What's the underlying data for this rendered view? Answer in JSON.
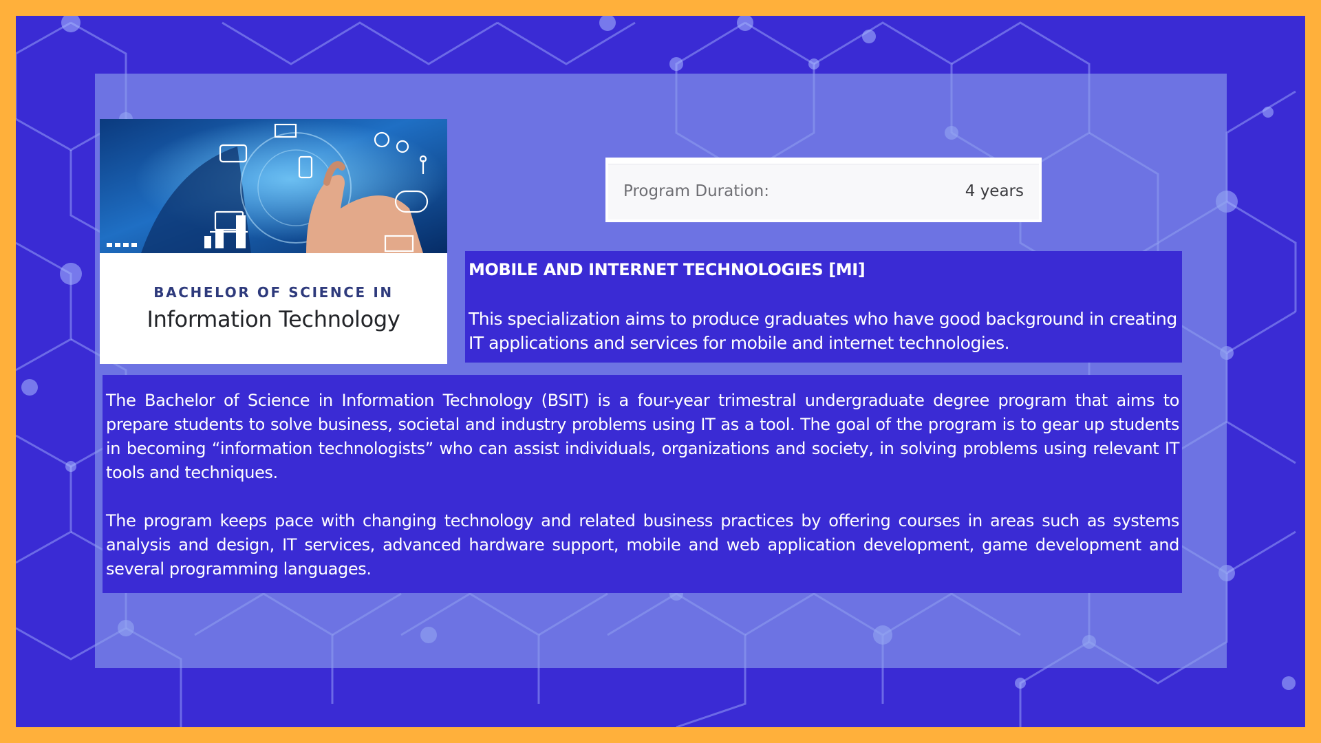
{
  "colors": {
    "frame": "#FFB03B",
    "background": "#3A2BD4",
    "panel": "#8CA0EB",
    "text_box": "#3A2BD4",
    "hero_subtitle": "#2E3A7C"
  },
  "hero": {
    "image_alt": "hand touching digital interface icons",
    "subtitle": "BACHELOR OF SCIENCE IN",
    "title": "Information Technology"
  },
  "program": {
    "duration_label": "Program Duration:",
    "duration_value": "4 years"
  },
  "specialization": {
    "title": "MOBILE AND INTERNET TECHNOLOGIES [MI]",
    "description": "This specialization aims to produce graduates who have good background in creating IT applications and services for mobile and internet technologies."
  },
  "about": {
    "paragraph_1": "The Bachelor of Science in Information Technology (BSIT) is a four-year trimestral undergraduate degree program that aims to prepare students to solve business, societal and industry problems using IT as a tool. The goal of the program is to gear up students in becoming “information technologists” who can assist individuals, organizations and society, in solving problems using relevant IT tools and techniques.",
    "paragraph_2": "The program keeps pace with changing technology and related business practices by offering courses in areas such as systems analysis and design, IT services, advanced hardware support, mobile and web application development, game development and several programming languages."
  }
}
